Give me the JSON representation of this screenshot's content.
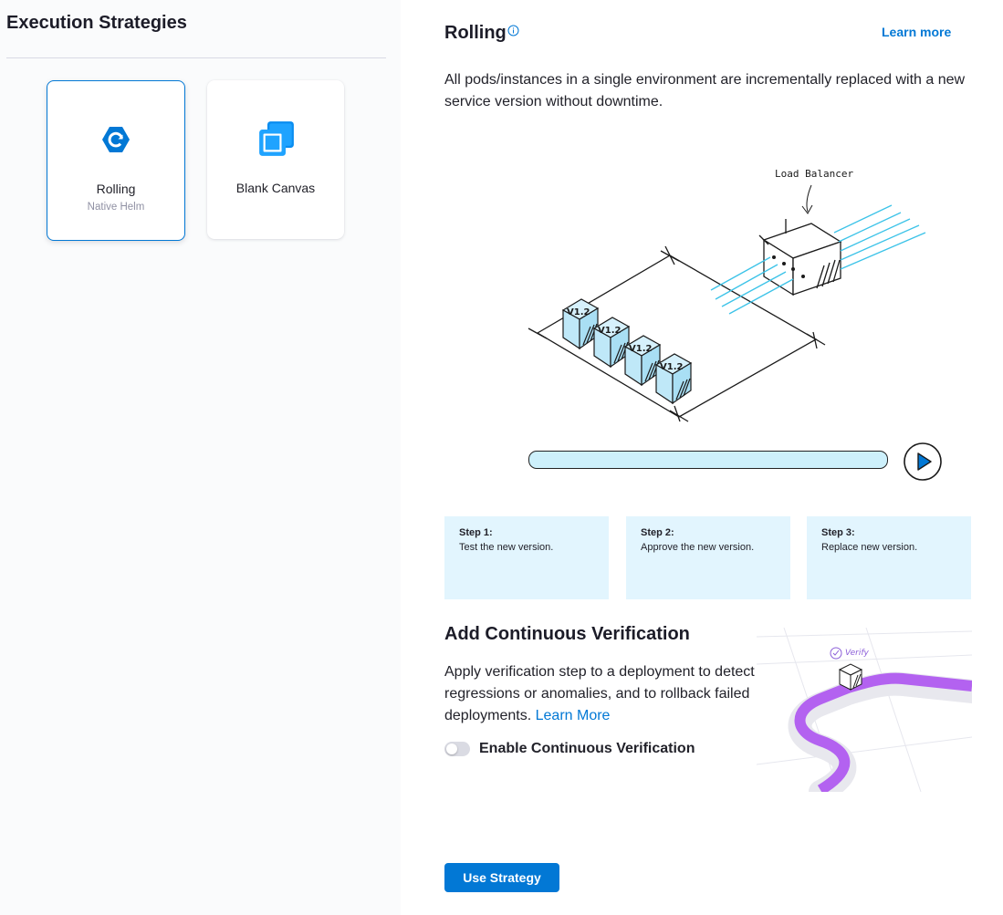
{
  "sidebar": {
    "title": "Execution Strategies",
    "cards": [
      {
        "label": "Rolling",
        "sublabel": "Native Helm",
        "icon": "rolling-hexagon-icon",
        "selected": true
      },
      {
        "label": "Blank Canvas",
        "sublabel": "",
        "icon": "blank-canvas-icon",
        "selected": false
      }
    ]
  },
  "detail": {
    "title": "Rolling",
    "learn_more": "Learn more",
    "description": "All pods/instances in a single environment are incrementally replaced with a new service version without downtime.",
    "illustration": {
      "load_balancer_label": "Load Balancer",
      "pod_labels": [
        "V1.2",
        "V1.2",
        "V1.2",
        "V1.2"
      ]
    },
    "steps": [
      {
        "title": "Step 1:",
        "text": "Test the new version."
      },
      {
        "title": "Step 2:",
        "text": "Approve the new version."
      },
      {
        "title": "Step 3:",
        "text": "Replace new version."
      }
    ]
  },
  "verification": {
    "title": "Add Continuous Verification",
    "description": "Apply verification step to a deployment to detect regressions or anomalies, and to rollback failed deployments.",
    "learn_more": "Learn More",
    "toggle_label": "Enable Continuous Verification",
    "toggle_enabled": false,
    "illustration_label": "Verify"
  },
  "actions": {
    "use_strategy": "Use Strategy"
  },
  "colors": {
    "primary": "#0278d5",
    "step_bg": "#e2f5fe",
    "pod_fill": "#bfe8f8",
    "path_purple": "#b362f0"
  }
}
